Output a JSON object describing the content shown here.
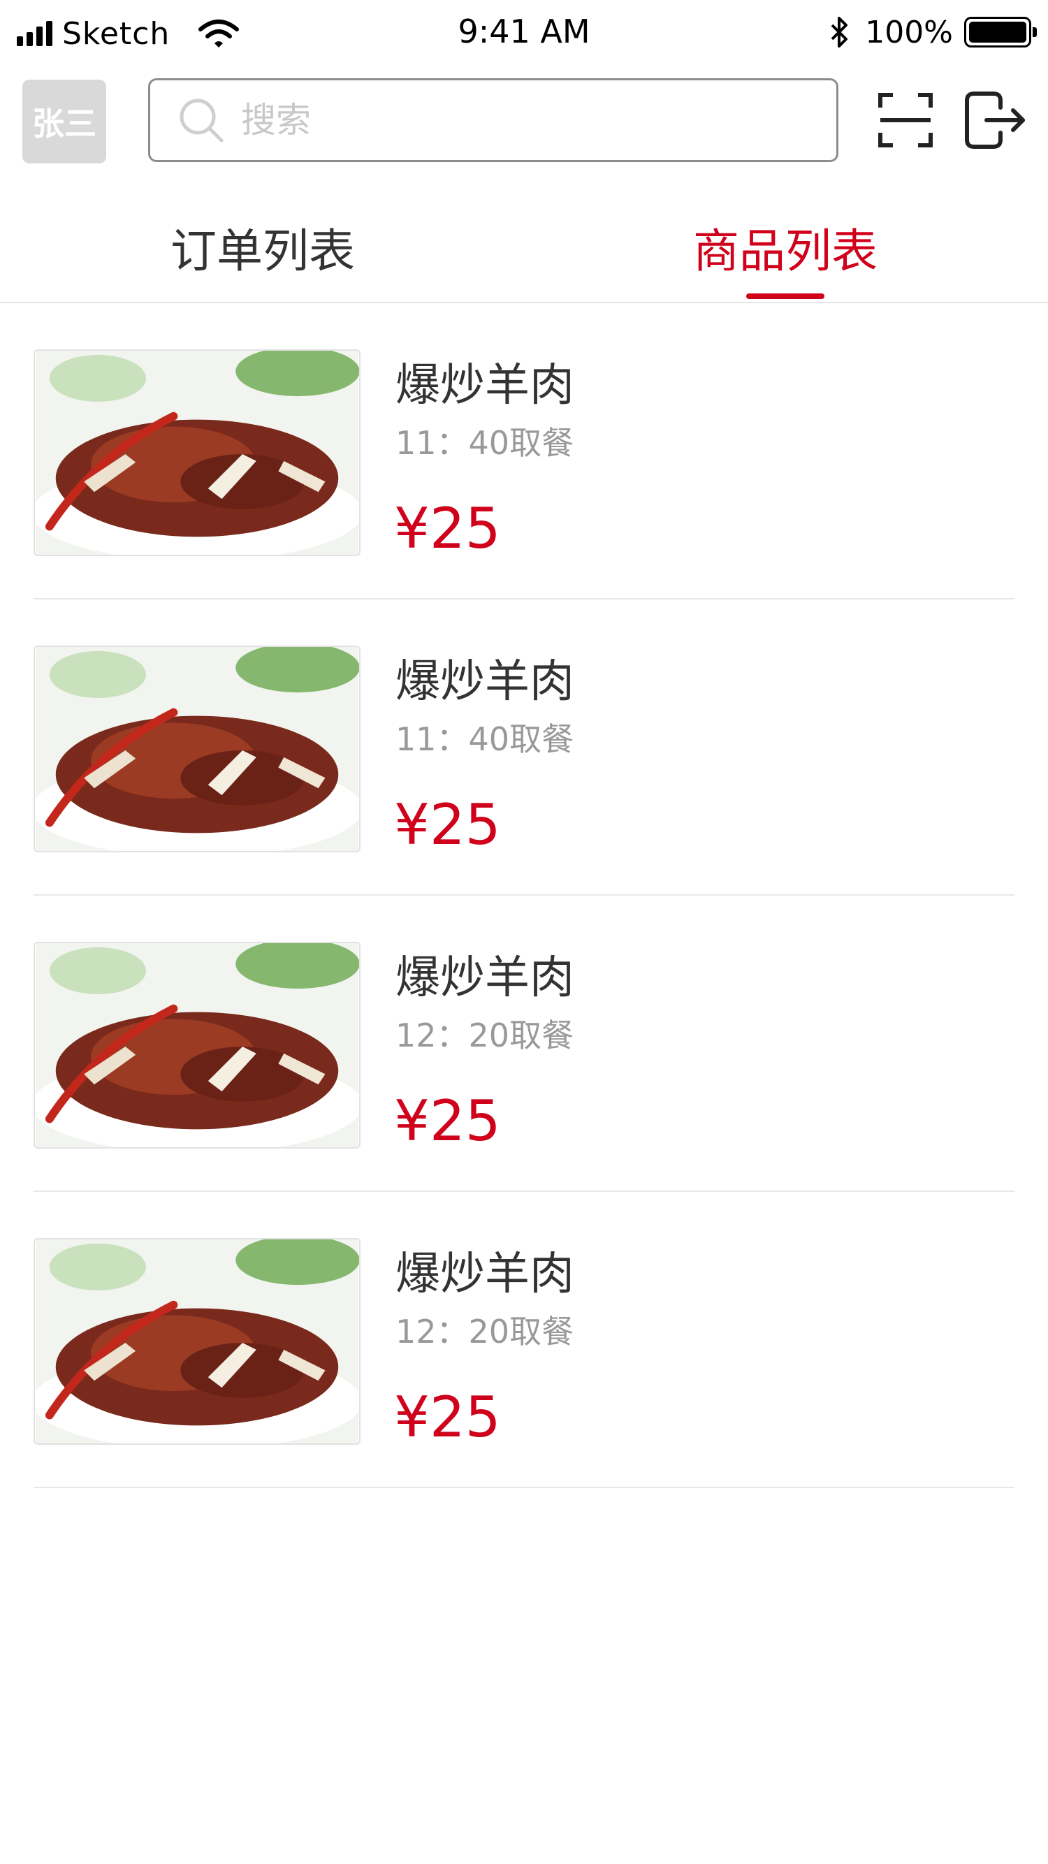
{
  "status_bar": {
    "carrier": "Sketch",
    "time": "9:41 AM",
    "battery": "100%"
  },
  "header": {
    "avatar_text": "张三",
    "search_placeholder": "搜索"
  },
  "tabs": {
    "orders": "订单列表",
    "products": "商品列表",
    "active": "products"
  },
  "colors": {
    "accent": "#d0021b",
    "text": "#333333",
    "subtext": "#999999",
    "avatar_bg": "#d9d9d9"
  },
  "products": [
    {
      "name": "爆炒羊肉",
      "pickup": "11：40取餐",
      "price": "¥25"
    },
    {
      "name": "爆炒羊肉",
      "pickup": "11：40取餐",
      "price": "¥25"
    },
    {
      "name": "爆炒羊肉",
      "pickup": "12：20取餐",
      "price": "¥25"
    },
    {
      "name": "爆炒羊肉",
      "pickup": "12：20取餐",
      "price": "¥25"
    }
  ]
}
